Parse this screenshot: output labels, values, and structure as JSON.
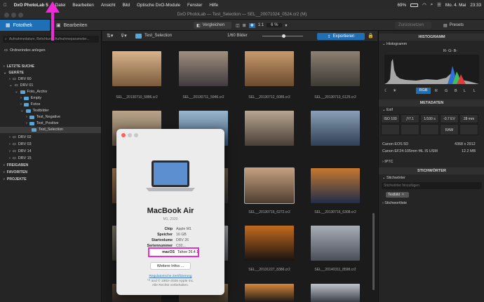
{
  "menubar": {
    "app": "DxO PhotoLab 5",
    "items": [
      "Datei",
      "Bearbeiten",
      "Ansicht",
      "Bild",
      "Optische DxO-Module",
      "Fenster",
      "Hilfe"
    ],
    "battery": "69%",
    "date": "Mo. 4. Mai",
    "time": "23:33"
  },
  "window": {
    "title": "DxO PhotoLab — Test_Selection — SEL__20071024_0524.cr2 (M)"
  },
  "tabs": {
    "fotothek": "Fotothek",
    "bearbeiten": "Bearbeiten",
    "vergleichen": "Vergleichen",
    "ratio": "1:1",
    "zoom": "6 %",
    "zurueck": "Zurücksetzen",
    "presets": "Presets"
  },
  "left": {
    "search_placeholder": "Aufnahmedatum, Belichtung, Aufnahmeparameter...",
    "index_label": "Ordnerindex anlegen",
    "sections": {
      "recent": "LETZTE SUCHE",
      "devices": "GERÄTE",
      "shares": "FREIGABEN",
      "favorites": "FAVORITEN",
      "projects": "PROJEKTE"
    },
    "tree": [
      "DRV 60",
      "DRV 01",
      "Foto_Archiv",
      "Empty",
      "Fotos",
      "Testbilder",
      "Test_Negative",
      "Test_Positive",
      "Test_Selection",
      "DRV 02",
      "DRV 03",
      "DRV 14",
      "DRV 15"
    ]
  },
  "center": {
    "path": "Test_Selection",
    "count": "1/60 Bilder",
    "export": "Exportieren",
    "thumbs": [
      "SEL__20130710_5886.cr2",
      "SEL__20130711_5946.cr2",
      "SEL__20130712_6085.cr2",
      "SEL__20130713_6125.cr2",
      "",
      "",
      "",
      "",
      "",
      "",
      "SEL__20130716_6272.cr2",
      "SEL__20130716_6308.cr2",
      "",
      "",
      "SEL__20131227_8386.cr2",
      "SEL__20140311_8598.cr2",
      "",
      "",
      "SEL__20140626_8376.cr2",
      "SEL__20150322_8618.cr2"
    ]
  },
  "dialog": {
    "model": "MacBook Air",
    "sub": "M1, 2020",
    "rows": [
      [
        "Chip",
        "Apple M1"
      ],
      [
        "Speicher",
        "16 GB"
      ],
      [
        "Startvolume",
        "DRV 26"
      ],
      [
        "Seriennummer",
        "C02..."
      ]
    ],
    "os_label": "macOS",
    "os_value": "Tahoe 26.4.1",
    "more": "Weitere Infos ...",
    "reg": "Regulatorische Zertifizierung",
    "copy": "™ and © 1983–2026 Apple Inc.",
    "rights": "Alle Rechte vorbehalten."
  },
  "right": {
    "hist_head": "HISTOGRAMM",
    "hist_sub": "Histogramm",
    "channels": "R- G- B-",
    "modes": [
      "RGB",
      "R",
      "G",
      "B",
      "L",
      "L"
    ],
    "meta_head": "METADATEN",
    "exif": "Exif",
    "exif_vals": [
      "ISO 100",
      "ƒ/7.1",
      "1/100 s",
      "-0.7 EV",
      "28 mm"
    ],
    "exif_vals2": [
      "",
      "",
      "",
      "RAW",
      ""
    ],
    "camera": "Canon EOS 5D",
    "dims": "4368 x 2912",
    "lens": "Canon EF24-105mm f4L IS USM",
    "size": "12.2 MB",
    "iptc": "IPTC",
    "kw_head": "STICHWÖRTER",
    "kw_sub": "Stichwörter",
    "kw_placeholder": "Stichwörter hinzufügen",
    "kw_tag": "Testbild",
    "kw_list": "Stichwortliste"
  },
  "colors": {
    "accent": "#1f6fb6",
    "annotation": "#ee2bd6"
  }
}
